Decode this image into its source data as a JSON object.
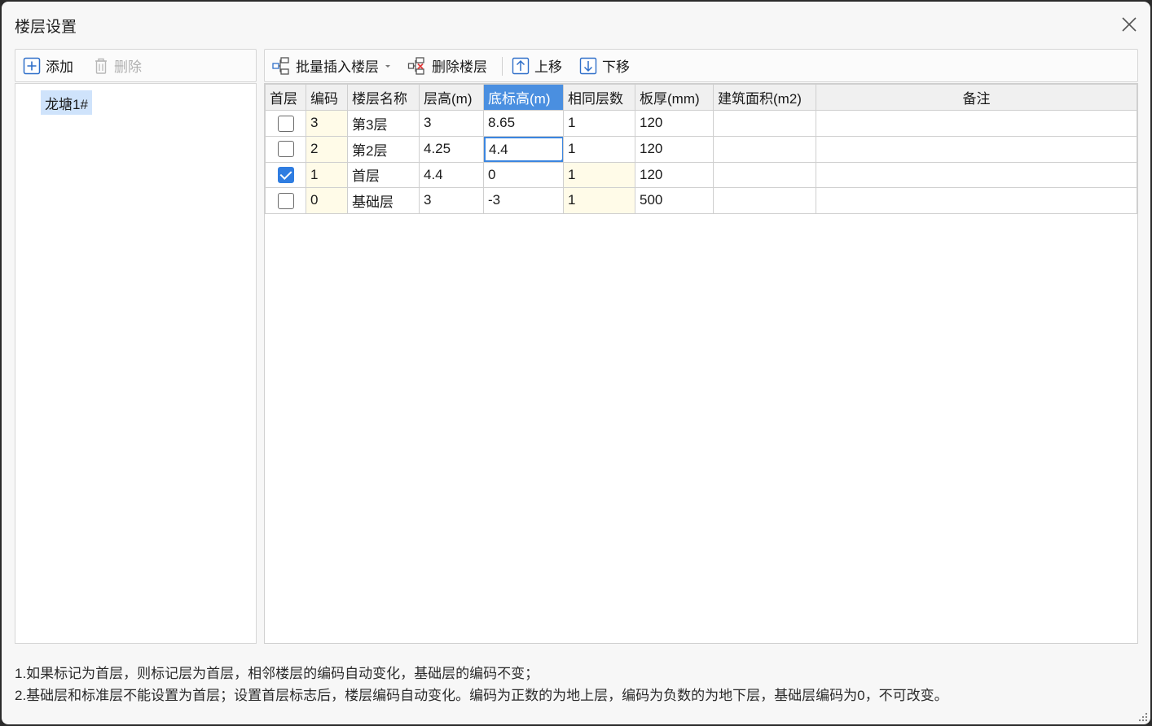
{
  "window": {
    "title": "楼层设置"
  },
  "left_toolbar": {
    "add_label": "添加",
    "delete_label": "删除"
  },
  "tree": {
    "items": [
      {
        "label": "龙塘1#",
        "selected": true
      }
    ]
  },
  "right_toolbar": {
    "batch_insert_label": "批量插入楼层",
    "delete_floor_label": "删除楼层",
    "move_up_label": "上移",
    "move_down_label": "下移"
  },
  "table": {
    "headers": [
      "首层",
      "编码",
      "楼层名称",
      "层高(m)",
      "底标高(m)",
      "相同层数",
      "板厚(mm)",
      "建筑面积(m2)",
      "备注"
    ],
    "selected_header": "底标高(m)",
    "rows": [
      {
        "first_floor": false,
        "code": "3",
        "name": "第3层",
        "height": "3",
        "bottom_elev": "8.65",
        "same_count": "1",
        "slab": "120",
        "area": "",
        "note": ""
      },
      {
        "first_floor": false,
        "code": "2",
        "name": "第2层",
        "height": "4.25",
        "bottom_elev": "4.4",
        "same_count": "1",
        "slab": "120",
        "area": "",
        "note": ""
      },
      {
        "first_floor": true,
        "code": "1",
        "name": "首层",
        "height": "4.4",
        "bottom_elev": "0",
        "same_count": "1",
        "slab": "120",
        "area": "",
        "note": ""
      },
      {
        "first_floor": false,
        "code": "0",
        "name": "基础层",
        "height": "3",
        "bottom_elev": "-3",
        "same_count": "1",
        "slab": "500",
        "area": "",
        "note": ""
      }
    ]
  },
  "notes": [
    "1.如果标记为首层，则标记层为首层，相邻楼层的编码自动变化，基础层的编码不变；",
    "2.基础层和标准层不能设置为首层；设置首层标志后，楼层编码自动变化。编码为正数的为地上层，编码为负数的为地下层，基础层编码为0，不可改变。"
  ],
  "colors": {
    "selection": "#4a8fe0",
    "checkbox_on": "#2f7de1",
    "yellow_cell": "#fffbe8",
    "tree_selected": "#cfe3fb"
  },
  "icons": [
    "close-icon",
    "add-icon",
    "trash-icon",
    "batch-insert-icon",
    "delete-floor-icon",
    "move-up-icon",
    "move-down-icon",
    "resize-grip-icon"
  ]
}
